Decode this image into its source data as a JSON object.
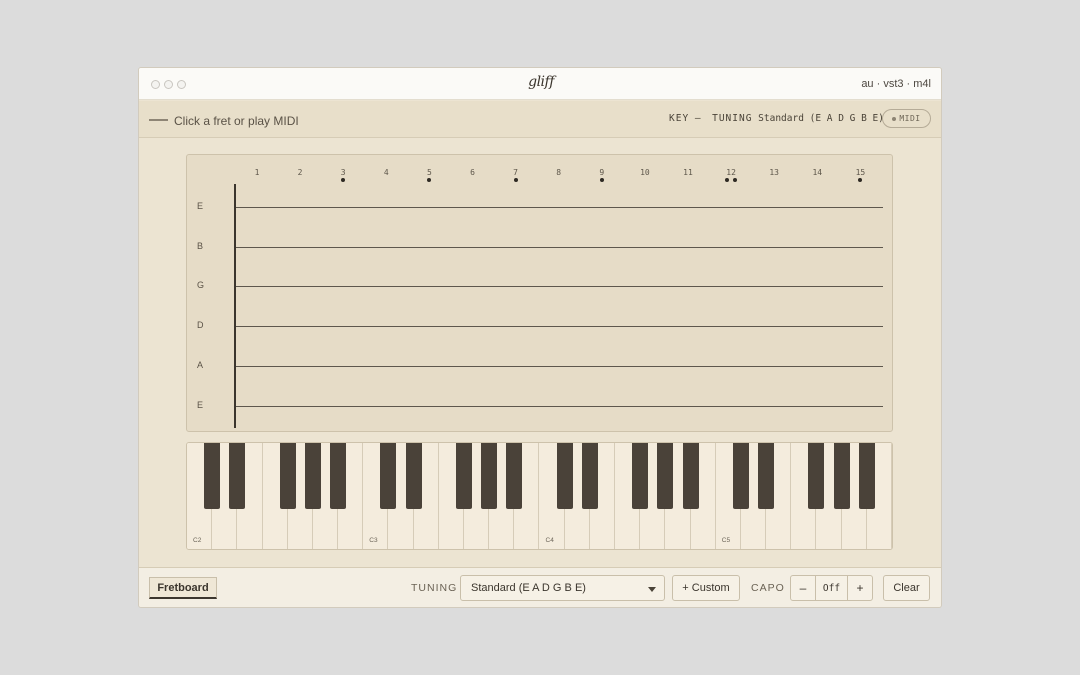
{
  "window": {
    "logo": "gliff",
    "formats": "au · vst3 · m4l"
  },
  "toolbar": {
    "hint": "Click a fret or play MIDI",
    "key_label": "KEY",
    "key_value": "—",
    "tuning_label": "TUNING",
    "tuning_value": "Standard (E A D G B E)",
    "midi_label": "MIDI"
  },
  "fretboard": {
    "fret_numbers": [
      "1",
      "2",
      "3",
      "4",
      "5",
      "6",
      "7",
      "8",
      "9",
      "10",
      "11",
      "12",
      "13",
      "14",
      "15"
    ],
    "single_inlay_frets": [
      3,
      5,
      7,
      9,
      15
    ],
    "double_inlay_frets": [
      12
    ],
    "strings": [
      "E",
      "B",
      "G",
      "D",
      "A",
      "E"
    ]
  },
  "keyboard": {
    "octave_labels": [
      "C2",
      "C3",
      "C4",
      "C5"
    ]
  },
  "bottombar": {
    "tab_label": "Fretboard",
    "tuning_label": "TUNING",
    "tuning_selected": "Standard (E A D G B E)",
    "custom_label": "+ Custom",
    "capo_label": "CAPO",
    "capo_minus": "–",
    "capo_value": "Off",
    "capo_plus": "+",
    "clear_label": "Clear"
  },
  "colors": {
    "background": "#ece4d2",
    "black_key": "#4a4239",
    "string": "#5e574d",
    "text": "#4a4338"
  }
}
